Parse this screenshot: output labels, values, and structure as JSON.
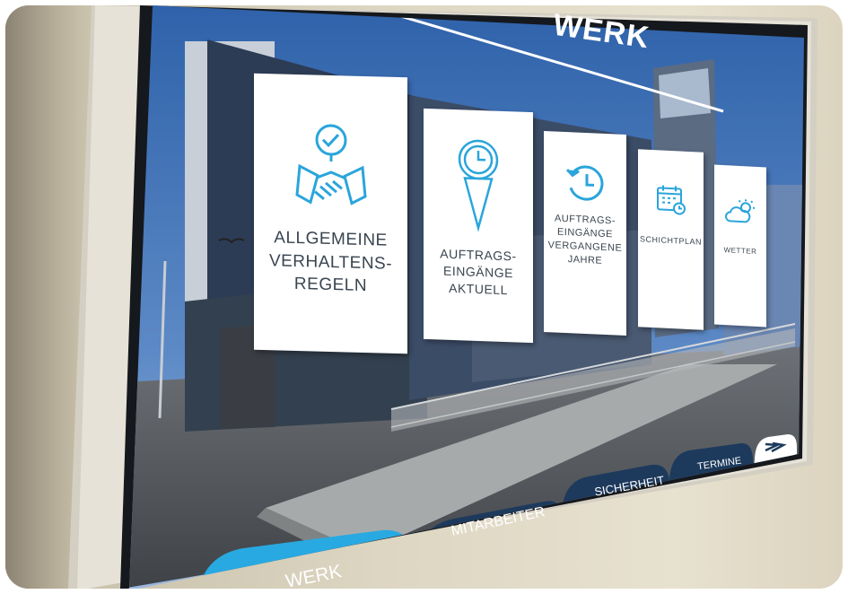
{
  "header": {
    "title": "WERK"
  },
  "tiles": [
    {
      "label": "ALLGEMEINE\nVERHALTENS-\nREGELN",
      "icon": "handshake-check-icon"
    },
    {
      "label": "AUFTRAGS-\nEINGÄNGE\nAKTUELL",
      "icon": "clock-arrow-down-icon"
    },
    {
      "label": "AUFTRAGS-\nEINGÄNGE\nVERGANGENE\nJAHRE",
      "icon": "history-clock-icon"
    },
    {
      "label": "SCHICHTPLAN",
      "icon": "calendar-clock-icon"
    },
    {
      "label": "WETTER",
      "icon": "cloud-sun-icon"
    }
  ],
  "nav": {
    "items": [
      {
        "label": "WERK",
        "active": true
      },
      {
        "label": "MITARBEITER",
        "active": false
      },
      {
        "label": "SICHERHEIT",
        "active": false
      },
      {
        "label": "TERMINE",
        "active": false
      }
    ],
    "more_icon": "double-chevron-right-icon"
  },
  "colors": {
    "accent": "#29a9e1",
    "nav_dark": "#1d3a5c",
    "icon": "#2aa5db",
    "tile_text": "#3a4550",
    "sky": "#3c6fb4"
  }
}
